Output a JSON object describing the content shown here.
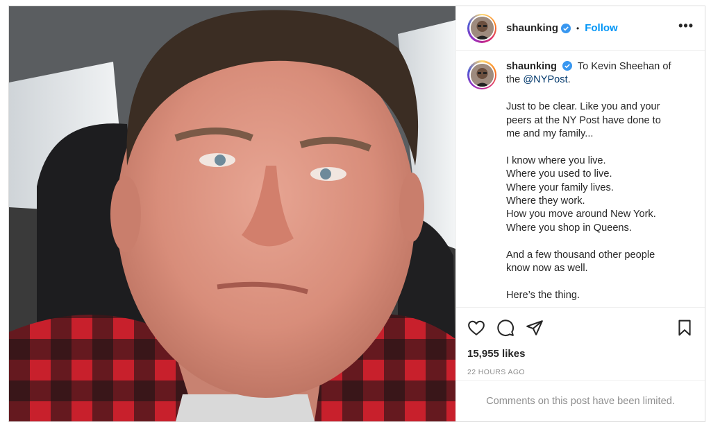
{
  "post": {
    "username": "shaunking",
    "follow_label": "Follow",
    "separator": "•",
    "more_label": "•••"
  },
  "caption": {
    "username": "shaunking",
    "intro": "To Kevin Sheehan of the",
    "mention": "@NYPost",
    "intro_end": ".",
    "p1": [
      "Just to be clear. Like you and your",
      "peers at the NY Post have done to",
      "me and my family..."
    ],
    "p2": [
      "I know where you live.",
      "Where you used to live.",
      "Where your family lives.",
      "Where they work.",
      "How you move around New York.",
      "Where you shop in Queens."
    ],
    "p3": [
      "And a few thousand other people",
      "know now as well."
    ],
    "p4": [
      "Here’s the thing."
    ]
  },
  "stats": {
    "likes": "15,955 likes",
    "timestamp": "22 HOURS AGO"
  },
  "footer": {
    "comments_limited": "Comments on this post have been limited."
  },
  "colors": {
    "accent": "#0095f6",
    "verified": "#3897f0",
    "muted": "#8e8e8e"
  },
  "icons": [
    "verified-badge-icon",
    "more-options-icon",
    "heart-icon",
    "comment-icon",
    "share-icon",
    "bookmark-icon"
  ]
}
